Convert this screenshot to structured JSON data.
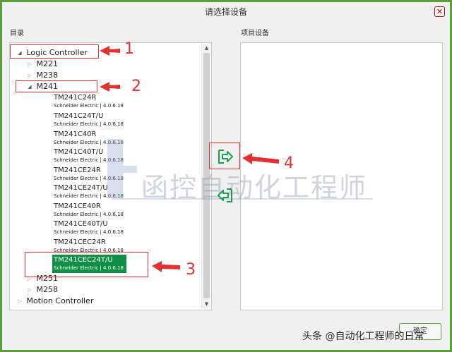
{
  "dialog": {
    "title": "请选择设备",
    "close_label": "✕",
    "left_label": "目录",
    "right_label": "项目设备",
    "ok_label": "确定"
  },
  "tree": {
    "logic_controller": "Logic Controller",
    "m221": "M221",
    "m238": "M238",
    "m241": "M241",
    "m251": "M251",
    "m258": "M258",
    "motion_controller": "Motion Controller",
    "devices": [
      {
        "name": "TM241C24R",
        "sub": "Schneider Electric | 4.0.6.18"
      },
      {
        "name": "TM241C24T/U",
        "sub": "Schneider Electric | 4.0.6.18"
      },
      {
        "name": "TM241C40R",
        "sub": "Schneider Electric | 4.0.6.18"
      },
      {
        "name": "TM241C40T/U",
        "sub": "Schneider Electric | 4.0.6.18"
      },
      {
        "name": "TM241CE24R",
        "sub": "Schneider Electric | 4.0.6.18"
      },
      {
        "name": "TM241CE24T/U",
        "sub": "Schneider Electric | 4.0.6.18"
      },
      {
        "name": "TM241CE40R",
        "sub": "Schneider Electric | 4.0.6.18"
      },
      {
        "name": "TM241CE40T/U",
        "sub": "Schneider Electric | 4.0.6.18"
      },
      {
        "name": "TM241CEC24R",
        "sub": "Schneider Electric | 4.0.6.18"
      },
      {
        "name": "TM241CEC24T/U",
        "sub": "Schneider Electric | 4.0.6.18"
      }
    ]
  },
  "callouts": [
    "1",
    "2",
    "3",
    "4"
  ],
  "watermark": "函控自动化工程师",
  "credit": "头条 @自动化工程师的日常",
  "colors": {
    "frame": "#5a9e3a",
    "selected": "#0f8f46",
    "callout": "#e53030",
    "move_icon": "#1aa04a"
  }
}
